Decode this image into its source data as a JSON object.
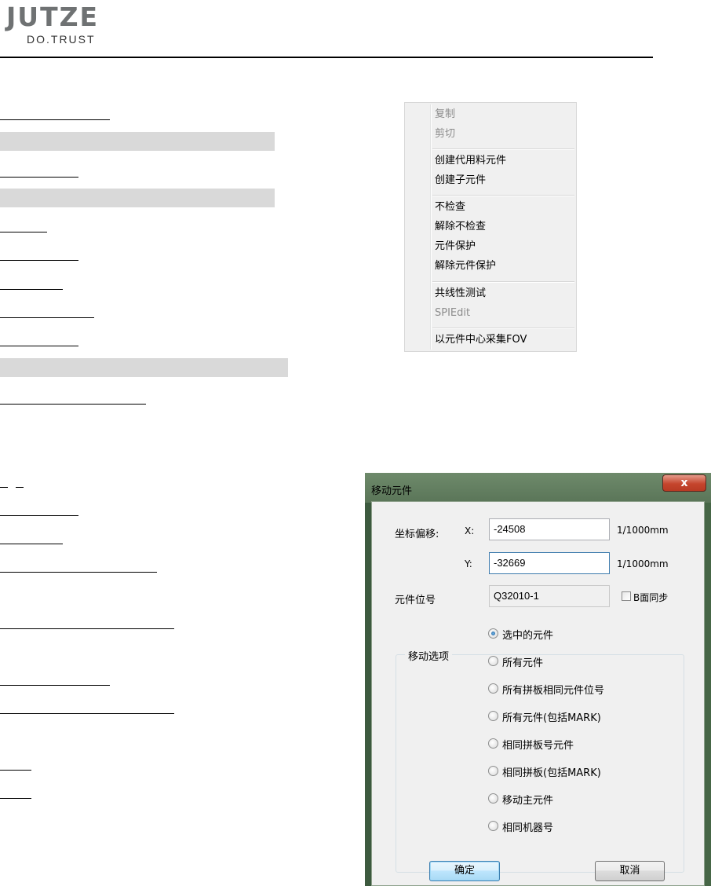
{
  "logo": {
    "mark": "JUTZE",
    "tagline": "DO.TRUST"
  },
  "context_menu": {
    "items": [
      {
        "label": "复制",
        "enabled": false
      },
      {
        "label": "剪切",
        "enabled": false
      },
      {
        "label": "创建代用料元件",
        "enabled": true
      },
      {
        "label": "创建子元件",
        "enabled": true
      },
      {
        "label": "不检查",
        "enabled": true
      },
      {
        "label": "解除不检查",
        "enabled": true
      },
      {
        "label": "元件保护",
        "enabled": true
      },
      {
        "label": "解除元件保护",
        "enabled": true
      },
      {
        "label": "共线性测试",
        "enabled": true
      },
      {
        "label": "SPIEdit",
        "enabled": false
      },
      {
        "label": "以元件中心采集FOV",
        "enabled": true
      }
    ]
  },
  "dialog": {
    "title": "移动元件",
    "close_glyph": "x",
    "offset_label": "坐标偏移:",
    "x_label": "X:",
    "x_value": "-24508",
    "x_unit": "1/1000mm",
    "y_label": "Y:",
    "y_value": "-32669",
    "y_unit": "1/1000mm",
    "ref_label": "元件位号",
    "ref_value": "Q32010-1",
    "sync_label": "B面同步",
    "sync_checked": false,
    "group_title": "移动选项",
    "options": [
      {
        "label": "选中的元件",
        "selected": true
      },
      {
        "label": "所有元件",
        "selected": false
      },
      {
        "label": "所有拼板相同元件位号",
        "selected": false
      },
      {
        "label": "所有元件(包括MARK)",
        "selected": false
      },
      {
        "label": "相同拼板号元件",
        "selected": false
      },
      {
        "label": "相同拼板(包括MARK)",
        "selected": false
      },
      {
        "label": "移动主元件",
        "selected": false
      },
      {
        "label": "相同机器号",
        "selected": false
      }
    ],
    "ok_label": "确定",
    "cancel_label": "取消"
  },
  "colors": {
    "logo_gray": "#6f7273",
    "band_gray": "#d9d9d9",
    "menu_bg": "#f0f0f0",
    "dialog_bg": "#f0f0f0",
    "close_red": "#c5452d",
    "default_button_blue": "#bee6fd"
  }
}
